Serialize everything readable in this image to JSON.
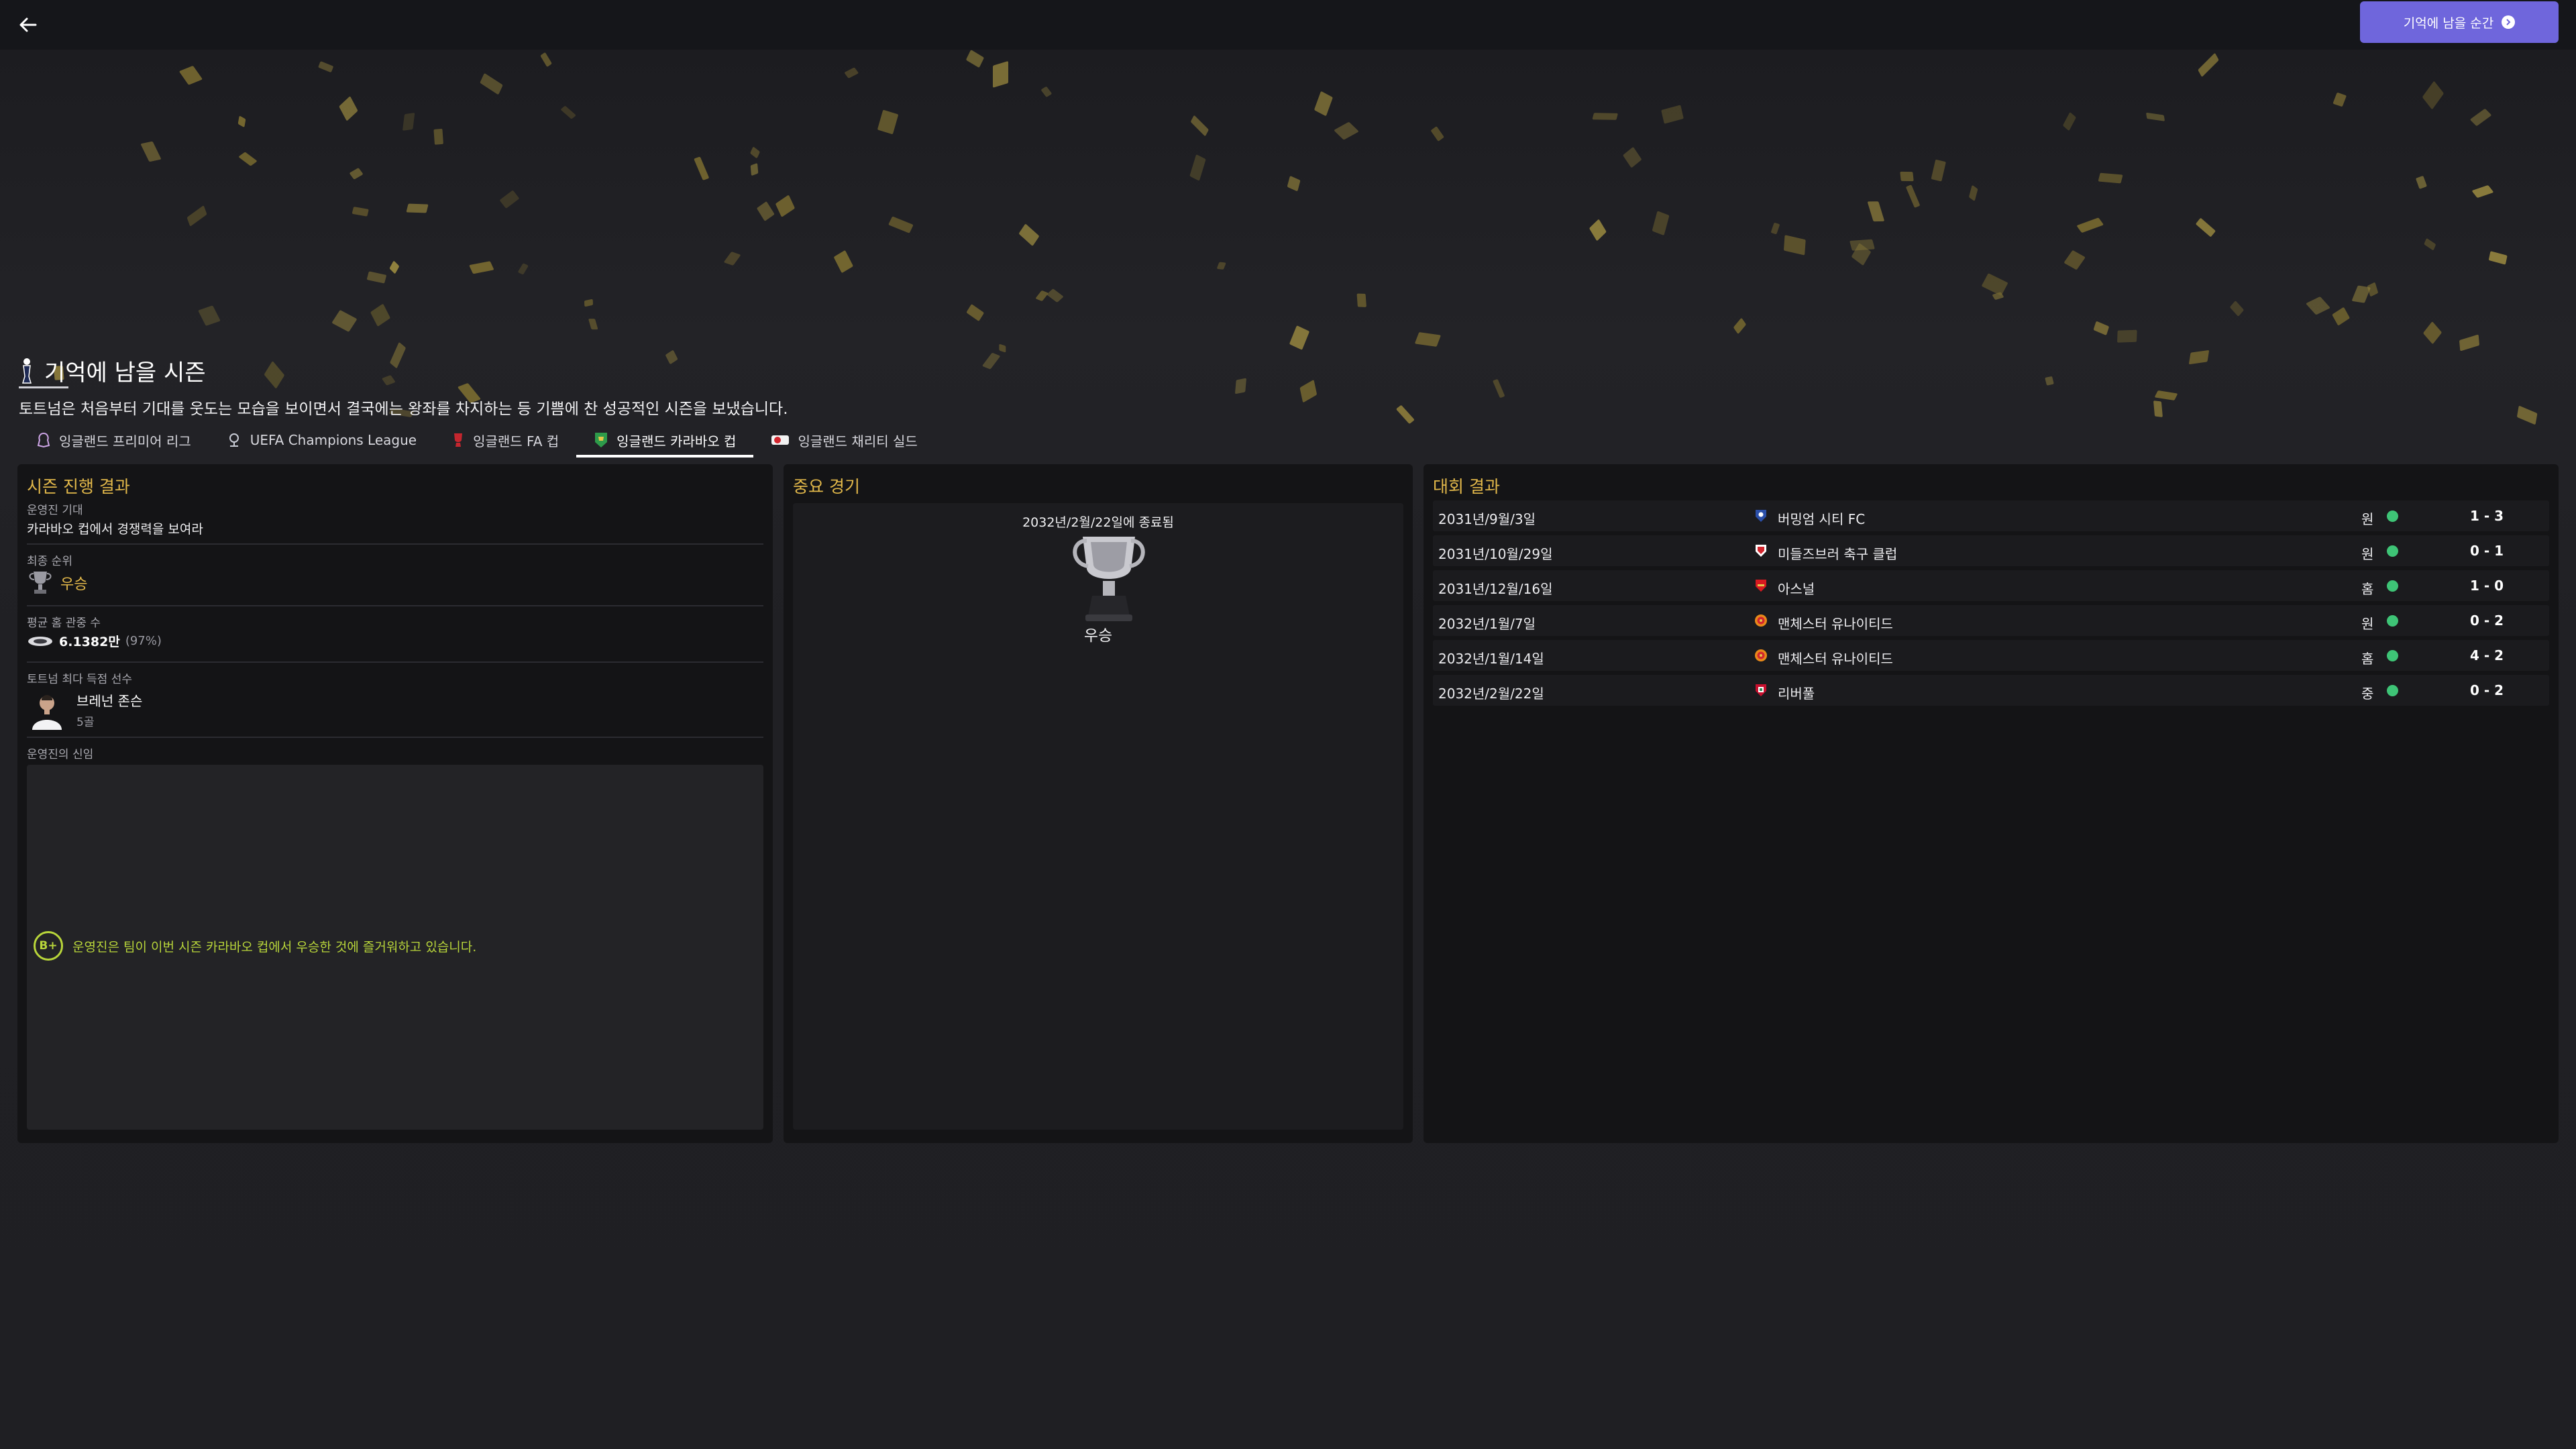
{
  "header": {
    "back_icon": "back-arrow-icon",
    "memorable_button": "기억에 남을 순간"
  },
  "season": {
    "title": "기억에 남을 시즌",
    "summary": "토트넘은 처음부터 기대를 웃도는 모습을 보이면서 결국에는 왕좌를 차지하는 등 기쁨에 찬 성공적인 시즌을 보냈습니다."
  },
  "tabs": [
    {
      "label": "잉글랜드 프리미어 리그",
      "icon": "premier-league-icon",
      "active": false
    },
    {
      "label": "UEFA Champions League",
      "icon": "champions-league-icon",
      "active": false
    },
    {
      "label": "잉글랜드 FA 컵",
      "icon": "fa-cup-icon",
      "active": false
    },
    {
      "label": "잉글랜드 카라바오 컵",
      "icon": "carabao-cup-icon",
      "active": true
    },
    {
      "label": "잉글랜드 채리티 실드",
      "icon": "community-shield-icon",
      "active": false
    }
  ],
  "season_progress": {
    "title": "시즌 진행 결과",
    "board_expectation_label": "운영진 기대",
    "board_expectation_value": "카라바오 컵에서 경쟁력을 보여라",
    "final_position_label": "최종 순위",
    "final_position_value": "우승",
    "avg_attendance_label": "평균 홈 관중 수",
    "avg_attendance_value": "6.1382만",
    "avg_attendance_pct": "(97%)",
    "top_scorer_label": "토트넘 최다 득점 선수",
    "top_scorer_name": "브레넌 존슨",
    "top_scorer_goals": "5골",
    "board_confidence_label": "운영진의 신임",
    "board_grade": "B+",
    "board_comment": "운영진은 팀이 이번 시즌 카라바오 컵에서 우승한 것에 즐거워하고 있습니다."
  },
  "key_match": {
    "title": "중요 경기",
    "ended_text": "2032년/2월/22일에 종료됨",
    "result": "우승",
    "trophy_icon": "trophy-icon"
  },
  "competition_results": {
    "title": "대회 결과",
    "rows": [
      {
        "date": "2031년/9월/3일",
        "team": "버밍엄 시티 FC",
        "crest_color": "#2b4fa8",
        "venue": "원",
        "score": "1 - 3"
      },
      {
        "date": "2031년/10월/29일",
        "team": "미들즈브러 축구 클럽",
        "crest_color": "#d3262e",
        "venue": "원",
        "score": "0 - 1"
      },
      {
        "date": "2031년/12월/16일",
        "team": "아스널",
        "crest_color": "#d71920",
        "venue": "홈",
        "score": "1 - 0"
      },
      {
        "date": "2032년/1월/7일",
        "team": "맨체스터 유나이티드",
        "crest_color": "#e8891a",
        "venue": "원",
        "score": "0 - 2"
      },
      {
        "date": "2032년/1월/14일",
        "team": "맨체스터 유나이티드",
        "crest_color": "#e8891a",
        "venue": "홈",
        "score": "4 - 2"
      },
      {
        "date": "2032년/2월/22일",
        "team": "리버풀",
        "crest_color": "#c8102e",
        "venue": "중",
        "score": "0 - 2"
      }
    ]
  },
  "colors": {
    "accent": "#6f66dc",
    "panel_title": "#e2b84a",
    "grade": "#b8d53a",
    "win_dot": "#3ec476"
  }
}
